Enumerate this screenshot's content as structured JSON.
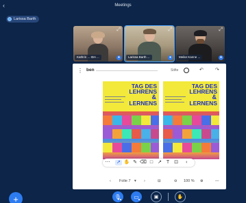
{
  "window": {
    "title": "Meetings"
  },
  "presenter": {
    "name": "Larissa Barth"
  },
  "participants": [
    {
      "name": "Kathrin ... IDA ...",
      "mic": "muted"
    },
    {
      "name": "Larissa Barth ...",
      "mic": "on"
    },
    {
      "name": "Meike Kanne ...",
      "mic": "muted"
    }
  ],
  "board": {
    "title": "ben",
    "tool_label": "Stifte",
    "posters": [
      {
        "line1": "TAG DES",
        "line2": "LEHRENS",
        "amp": "&",
        "line3": "LERNENS"
      },
      {
        "line1": "TAG DES",
        "line2": "LEHRENS",
        "amp": "&",
        "line3": "LERNENS"
      }
    ]
  },
  "nav": {
    "page": "Folie 7",
    "zoom": "100 %"
  },
  "icons": {
    "back": "back-arrow-icon",
    "expand": "expand-icon",
    "undo": "undo-icon",
    "redo": "redo-icon"
  },
  "colors": {
    "background": "#0c2548",
    "accent": "#2d7bf0",
    "poster_yellow": "#f2e93b",
    "poster_blue": "#1d2fc8"
  }
}
